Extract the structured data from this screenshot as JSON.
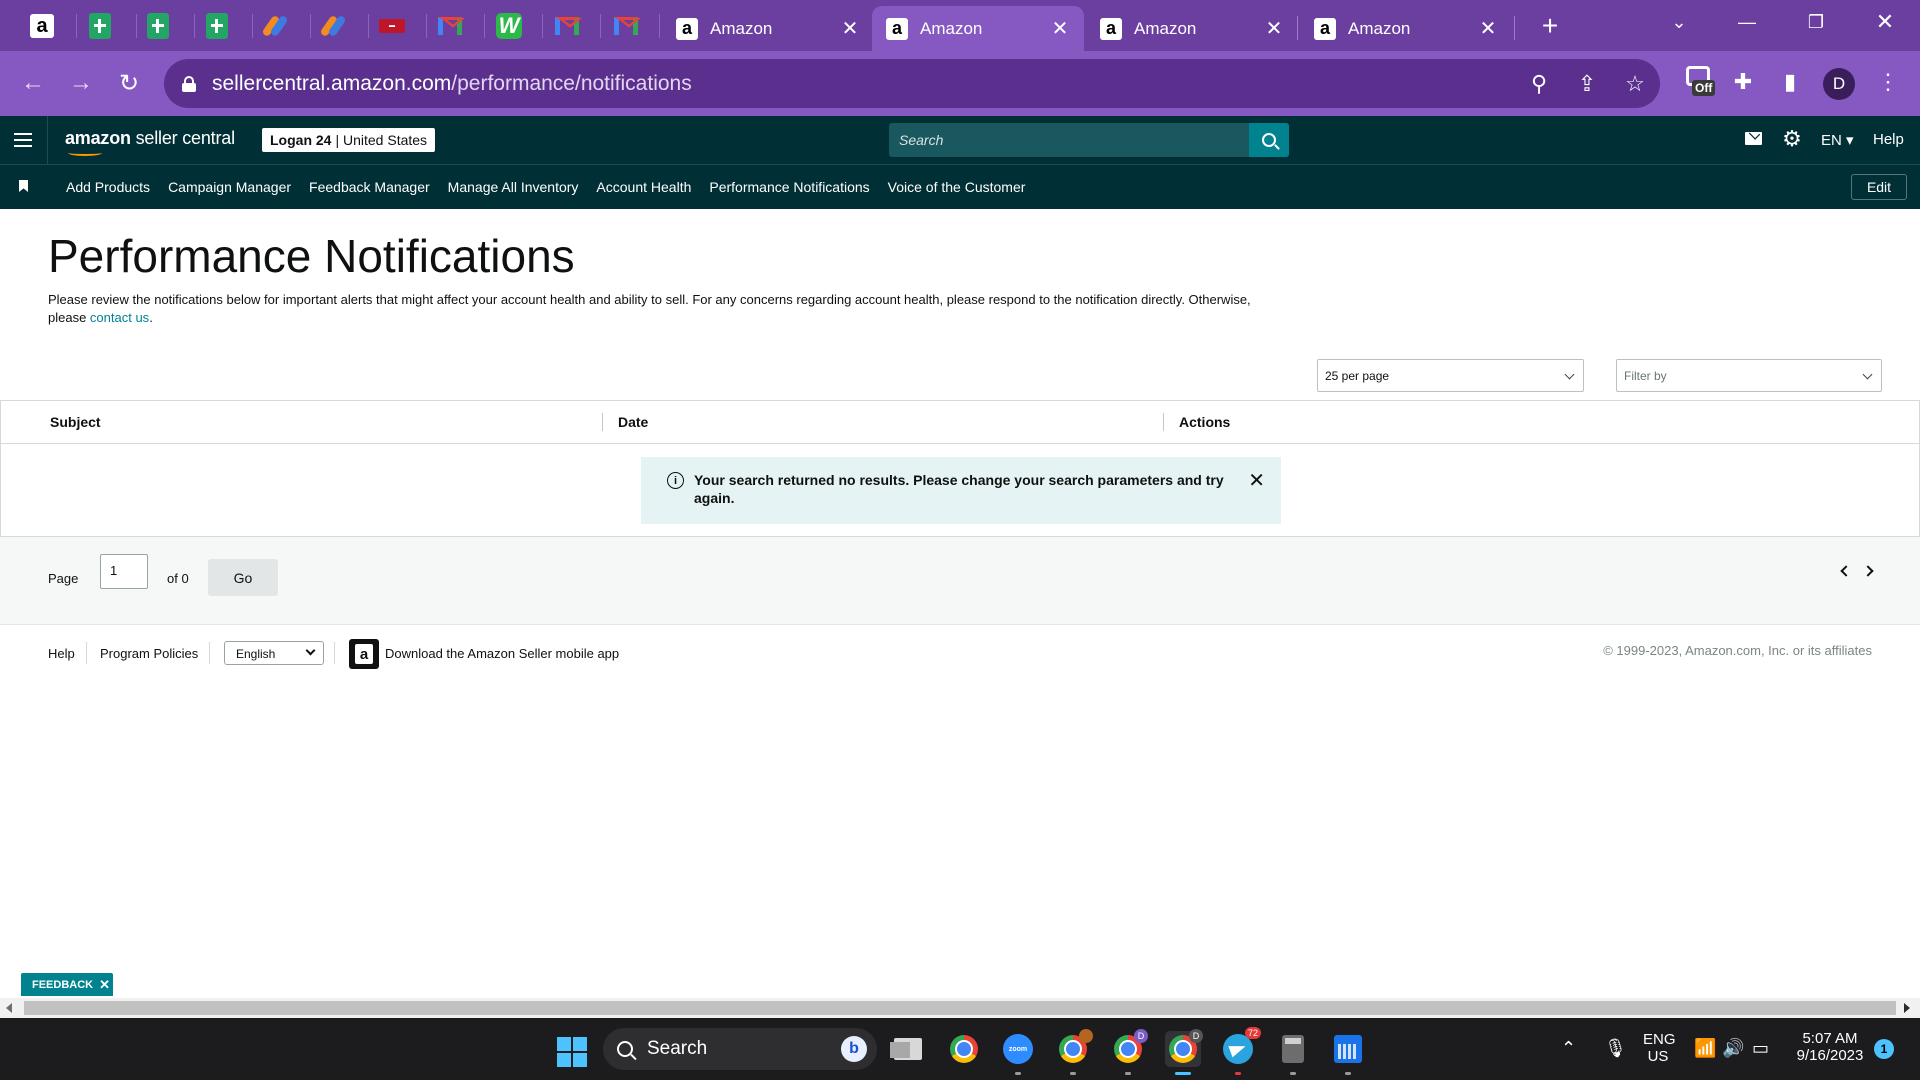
{
  "browser": {
    "tabs": [
      {
        "title": "Amazon",
        "active": false
      },
      {
        "title": "Amazon",
        "active": true
      },
      {
        "title": "Amazon",
        "active": false
      },
      {
        "title": "Amazon",
        "active": false
      }
    ],
    "url_host": "sellercentral.amazon.com",
    "url_path": "/performance/notifications",
    "extension_badge": "Off",
    "profile_initial": "D"
  },
  "header": {
    "logo_bold": "amazon",
    "logo_rest": " seller central",
    "store_name": "Logan 24",
    "store_region": "| United States",
    "search_placeholder": "Search",
    "language": "EN",
    "help": "Help"
  },
  "nav": {
    "links": [
      "Add Products",
      "Campaign Manager",
      "Feedback Manager",
      "Manage All Inventory",
      "Account Health",
      "Performance Notifications",
      "Voice of the Customer"
    ],
    "edit_label": "Edit"
  },
  "page": {
    "title": "Performance Notifications",
    "intro_text": "Please review the notifications below for important alerts that might affect your account health and ability to sell. For any concerns regarding account health, please respond to the notification directly. Otherwise, please ",
    "intro_link": "contact us",
    "intro_end": ".",
    "per_page": "25 per page",
    "filter_placeholder": "Filter by"
  },
  "table": {
    "columns": [
      "Subject",
      "Date",
      "Actions"
    ],
    "alert_message": "Your search returned no results. Please change your search parameters and try again."
  },
  "pagination": {
    "page_label": "Page",
    "current_page": "1",
    "of_label": "of 0",
    "go_label": "Go"
  },
  "footer": {
    "help": "Help",
    "policies": "Program Policies",
    "language": "English",
    "app_text": "Download the Amazon Seller mobile app",
    "copyright": "© 1999-2023, Amazon.com, Inc. or its affiliates"
  },
  "feedback_label": "FEEDBACK",
  "taskbar": {
    "search_label": "Search",
    "telegram_count": "72",
    "lang_top": "ENG",
    "lang_bottom": "US",
    "time": "5:07 AM",
    "date": "9/16/2023",
    "notification_count": "1"
  }
}
